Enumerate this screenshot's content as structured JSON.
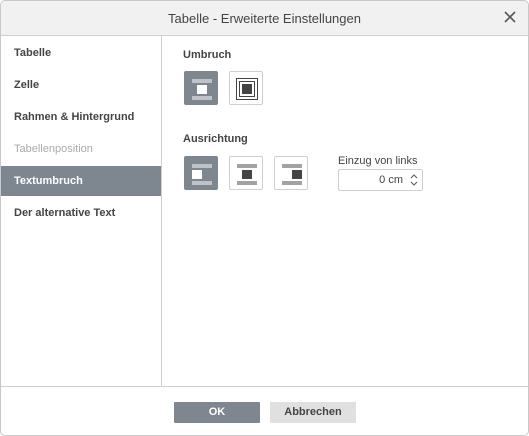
{
  "window": {
    "title": "Tabelle - Erweiterte Einstellungen"
  },
  "sidebar": {
    "items": [
      {
        "label": "Tabelle",
        "state": "normal"
      },
      {
        "label": "Zelle",
        "state": "normal"
      },
      {
        "label": "Rahmen & Hintergrund",
        "state": "normal"
      },
      {
        "label": "Tabellenposition",
        "state": "disabled"
      },
      {
        "label": "Textumbruch",
        "state": "active"
      },
      {
        "label": "Der alternative Text",
        "state": "normal"
      }
    ]
  },
  "wrap": {
    "label": "Umbruch",
    "options": [
      {
        "name": "inline",
        "icon": "wrap-inline-icon",
        "selected": true
      },
      {
        "name": "flow",
        "icon": "wrap-flow-icon",
        "selected": false
      }
    ]
  },
  "alignment": {
    "label": "Ausrichtung",
    "options": [
      {
        "name": "left",
        "icon": "align-left-icon",
        "selected": true
      },
      {
        "name": "center",
        "icon": "align-center-icon",
        "selected": false
      },
      {
        "name": "right",
        "icon": "align-right-icon",
        "selected": false
      }
    ],
    "indent": {
      "label": "Einzug von links",
      "value": "0 cm"
    }
  },
  "footer": {
    "ok_label": "OK",
    "cancel_label": "Abbrechen"
  },
  "colors": {
    "accent": "#7e8790",
    "border": "#cfcfcf",
    "title_bar": "#f1f1f1"
  }
}
